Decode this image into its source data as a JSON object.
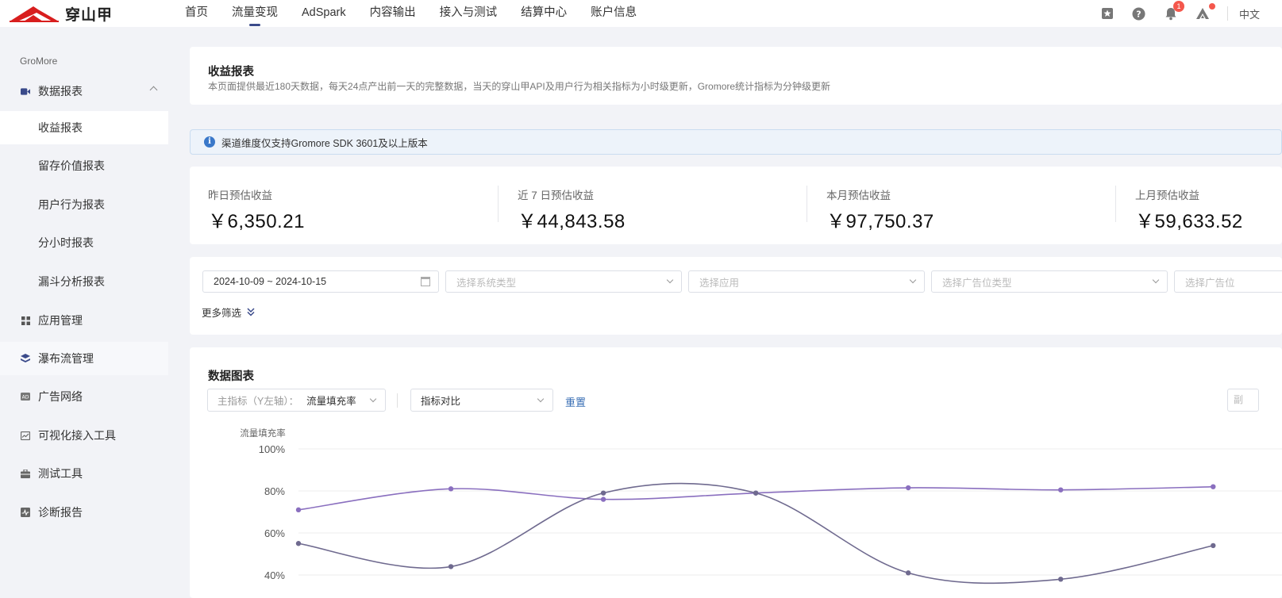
{
  "brand": {
    "name": "穿山甲"
  },
  "nav": [
    {
      "label": "首页",
      "active": false
    },
    {
      "label": "流量变现",
      "active": true
    },
    {
      "label": "AdSpark",
      "active": false
    },
    {
      "label": "内容输出",
      "active": false
    },
    {
      "label": "接入与测试",
      "active": false
    },
    {
      "label": "结算中心",
      "active": false
    },
    {
      "label": "账户信息",
      "active": false
    }
  ],
  "topbar": {
    "notification_count": "1",
    "language": "中文"
  },
  "sidebar": {
    "section": "GroMore",
    "data_reports": "数据报表",
    "sub_items": [
      "收益报表",
      "留存价值报表",
      "用户行为报表",
      "分小时报表",
      "漏斗分析报表"
    ],
    "items": [
      "应用管理",
      "瀑布流管理",
      "广告网络",
      "可视化接入工具",
      "测试工具",
      "诊断报告"
    ]
  },
  "page": {
    "title": "收益报表",
    "description": "本页面提供最近180天数据，每天24点产出前一天的完整数据，当天的穿山甲API及用户行为相关指标为小时级更新，Gromore统计指标为分钟级更新"
  },
  "notice": "渠道维度仅支持Gromore SDK 3601及以上版本",
  "stats": [
    {
      "label": "昨日预估收益",
      "value": "￥6,350.21"
    },
    {
      "label": "近 7 日预估收益",
      "value": "￥44,843.58"
    },
    {
      "label": "本月预估收益",
      "value": "￥97,750.37"
    },
    {
      "label": "上月预估收益",
      "value": "￥59,633.52"
    }
  ],
  "filters": {
    "date_range": "2024-10-09 ~ 2024-10-15",
    "system_type_placeholder": "选择系统类型",
    "app_placeholder": "选择应用",
    "ad_slot_type_placeholder": "选择广告位类型",
    "ad_slot_placeholder": "选择广告位",
    "more": "更多筛选"
  },
  "chart_section": {
    "title": "数据图表",
    "primary_metric_prefix": "主指标（Y左轴）：",
    "primary_metric_value": "流量填充率",
    "compare_label": "指标对比",
    "reset_label": "重置",
    "right_control": "副"
  },
  "chart_data": {
    "type": "line",
    "ylabel": "流量填充率",
    "y_ticks": [
      "100%",
      "80%",
      "60%",
      "40%"
    ],
    "ylim": [
      40,
      100
    ],
    "x": [
      0,
      1,
      2,
      3,
      4,
      5,
      6
    ],
    "series": [
      {
        "values": [
          71,
          81,
          76,
          79,
          81.5,
          80.5,
          82
        ],
        "color": "#8a6fbf"
      },
      {
        "values": [
          55,
          44,
          79,
          79,
          41,
          38,
          54
        ],
        "color": "#6f6a8f"
      }
    ],
    "grid": true,
    "visible_x_fraction": 0.93
  }
}
